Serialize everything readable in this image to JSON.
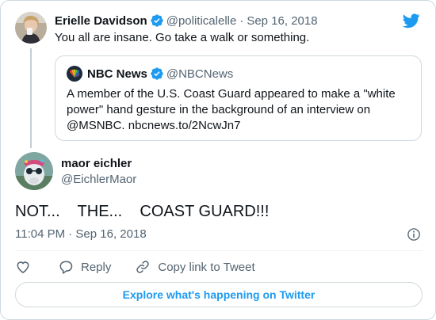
{
  "parent_tweet": {
    "author_name": "Erielle Davidson",
    "author_handle": "@politicalelle",
    "separator": "·",
    "date": "Sep 16, 2018",
    "text": "You all are insane. Go take a walk or something."
  },
  "quoted_tweet": {
    "author_name": "NBC News",
    "author_handle": "@NBCNews",
    "text": "A member of the U.S. Coast Guard appeared to make a \"white power\" hand gesture in the background of an interview on @MSNBC. nbcnews.to/2NcwJn7"
  },
  "main_tweet": {
    "author_name": "maor eichler",
    "author_handle": "@EichlerMaor",
    "text": "NOT...    THE...    COAST GUARD!!!",
    "time": "11:04 PM · Sep 16, 2018"
  },
  "actions": {
    "reply_label": "Reply",
    "copy_link_label": "Copy link to Tweet"
  },
  "explore_button": "Explore what's happening on Twitter",
  "colors": {
    "twitter_blue": "#1d9bf0",
    "text_primary": "#0f1419",
    "text_secondary": "#536471",
    "border": "#cfd9de"
  },
  "icons": [
    "twitter-bird-icon",
    "verified-badge-icon",
    "info-icon",
    "heart-icon",
    "reply-icon",
    "link-icon",
    "nbc-peacock-icon"
  ]
}
